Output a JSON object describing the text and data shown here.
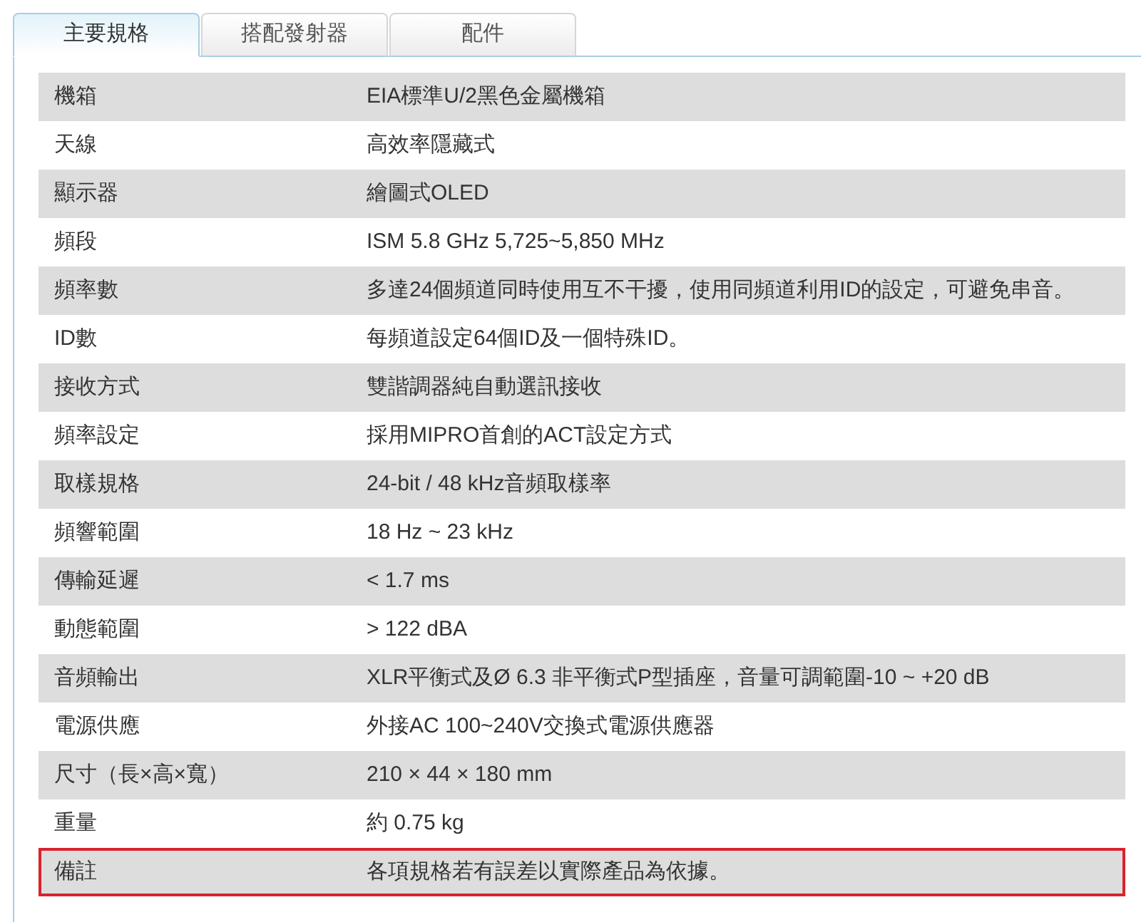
{
  "tabs": [
    {
      "label": "主要規格",
      "selected": true
    },
    {
      "label": "搭配發射器",
      "selected": false
    },
    {
      "label": "配件",
      "selected": false
    }
  ],
  "specs": [
    {
      "name": "機箱",
      "value": "EIA標準U/2黑色金屬機箱",
      "highlighted": false
    },
    {
      "name": "天線",
      "value": "高效率隱藏式",
      "highlighted": false
    },
    {
      "name": "顯示器",
      "value": "繪圖式OLED",
      "highlighted": false
    },
    {
      "name": "頻段",
      "value": "ISM 5.8 GHz 5,725~5,850 MHz",
      "highlighted": false
    },
    {
      "name": "頻率數",
      "value": "多達24個頻道同時使用互不干擾，使用同頻道利用ID的設定，可避免串音。",
      "highlighted": false
    },
    {
      "name": "ID數",
      "value": "每頻道設定64個ID及一個特殊ID。",
      "highlighted": false
    },
    {
      "name": "接收方式",
      "value": "雙諧調器純自動選訊接收",
      "highlighted": false
    },
    {
      "name": "頻率設定",
      "value": "採用MIPRO首創的ACT設定方式",
      "highlighted": false
    },
    {
      "name": "取樣規格",
      "value": "24-bit / 48 kHz音頻取樣率",
      "highlighted": false
    },
    {
      "name": "頻響範圍",
      "value": "18 Hz ~ 23 kHz",
      "highlighted": false
    },
    {
      "name": "傳輸延遲",
      "value": "< 1.7 ms",
      "highlighted": false
    },
    {
      "name": "動態範圍",
      "value": "> 122 dBA",
      "highlighted": false
    },
    {
      "name": "音頻輸出",
      "value": "XLR平衡式及Ø 6.3 非平衡式P型插座，音量可調範圍-10 ~ +20 dB",
      "highlighted": false
    },
    {
      "name": "電源供應",
      "value": "外接AC 100~240V交換式電源供應器",
      "highlighted": false
    },
    {
      "name": "尺寸（長×高×寬）",
      "value": "210 × 44 × 180 mm",
      "highlighted": false
    },
    {
      "name": "重量",
      "value": "約 0.75 kg",
      "highlighted": false
    },
    {
      "name": "備註",
      "value": "各項規格若有誤差以實際產品為依據。",
      "highlighted": true
    }
  ]
}
